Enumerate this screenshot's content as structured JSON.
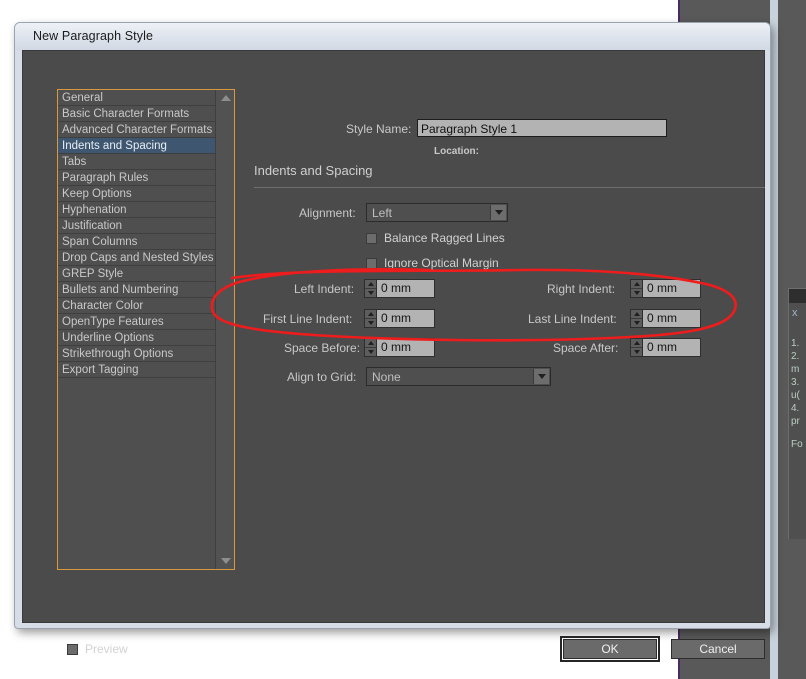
{
  "window": {
    "title": "New Paragraph Style"
  },
  "sidebar": {
    "items": [
      {
        "label": "General",
        "selected": false
      },
      {
        "label": "Basic Character Formats",
        "selected": false
      },
      {
        "label": "Advanced Character Formats",
        "selected": false
      },
      {
        "label": "Indents and Spacing",
        "selected": true
      },
      {
        "label": "Tabs",
        "selected": false
      },
      {
        "label": "Paragraph Rules",
        "selected": false
      },
      {
        "label": "Keep Options",
        "selected": false
      },
      {
        "label": "Hyphenation",
        "selected": false
      },
      {
        "label": "Justification",
        "selected": false
      },
      {
        "label": "Span Columns",
        "selected": false
      },
      {
        "label": "Drop Caps and Nested Styles",
        "selected": false
      },
      {
        "label": "GREP Style",
        "selected": false
      },
      {
        "label": "Bullets and Numbering",
        "selected": false
      },
      {
        "label": "Character Color",
        "selected": false
      },
      {
        "label": "OpenType Features",
        "selected": false
      },
      {
        "label": "Underline Options",
        "selected": false
      },
      {
        "label": "Strikethrough Options",
        "selected": false
      },
      {
        "label": "Export Tagging",
        "selected": false
      }
    ],
    "scrollbar": {
      "up_icon": "triangle-up-icon",
      "down_icon": "triangle-down-icon"
    }
  },
  "form": {
    "style_name_label": "Style Name:",
    "style_name_value": "Paragraph Style 1",
    "location_label": "Location:",
    "pane_title": "Indents and Spacing",
    "alignment_label": "Alignment:",
    "alignment_value": "Left",
    "balance_ragged_lines_label": "Balance Ragged Lines",
    "ignore_optical_margin_label": "Ignore Optical Margin",
    "left_indent_label": "Left Indent:",
    "left_indent_value": "0 mm",
    "right_indent_label": "Right Indent:",
    "right_indent_value": "0 mm",
    "first_line_indent_label": "First Line Indent:",
    "first_line_indent_value": "0 mm",
    "last_line_indent_label": "Last Line Indent:",
    "last_line_indent_value": "0 mm",
    "space_before_label": "Space Before:",
    "space_before_value": "0 mm",
    "space_after_label": "Space After:",
    "space_after_value": "0 mm",
    "align_to_grid_label": "Align to Grid:",
    "align_to_grid_value": "None"
  },
  "footer": {
    "preview_label": "Preview",
    "ok_label": "OK",
    "cancel_label": "Cancel"
  },
  "background_panel": {
    "close_glyph": "x",
    "lines": [
      "1.",
      "2.",
      "m",
      "3.",
      "u(",
      "4.",
      "pr"
    ],
    "footer_fragment": "Fo"
  },
  "annotation": {
    "type": "hand-drawn-ellipse",
    "color": "#ee1c1c",
    "encircles": [
      "Space Before:",
      "Space After:",
      "Align to Grid:"
    ]
  },
  "colors": {
    "dialog_body": "#4b4b4b",
    "titlebar": "#dde3ec",
    "selection": "#3f5670",
    "list_border": "#d89a3c",
    "field_bg": "#b3b3b3",
    "annotation_red": "#ee1c1c"
  }
}
